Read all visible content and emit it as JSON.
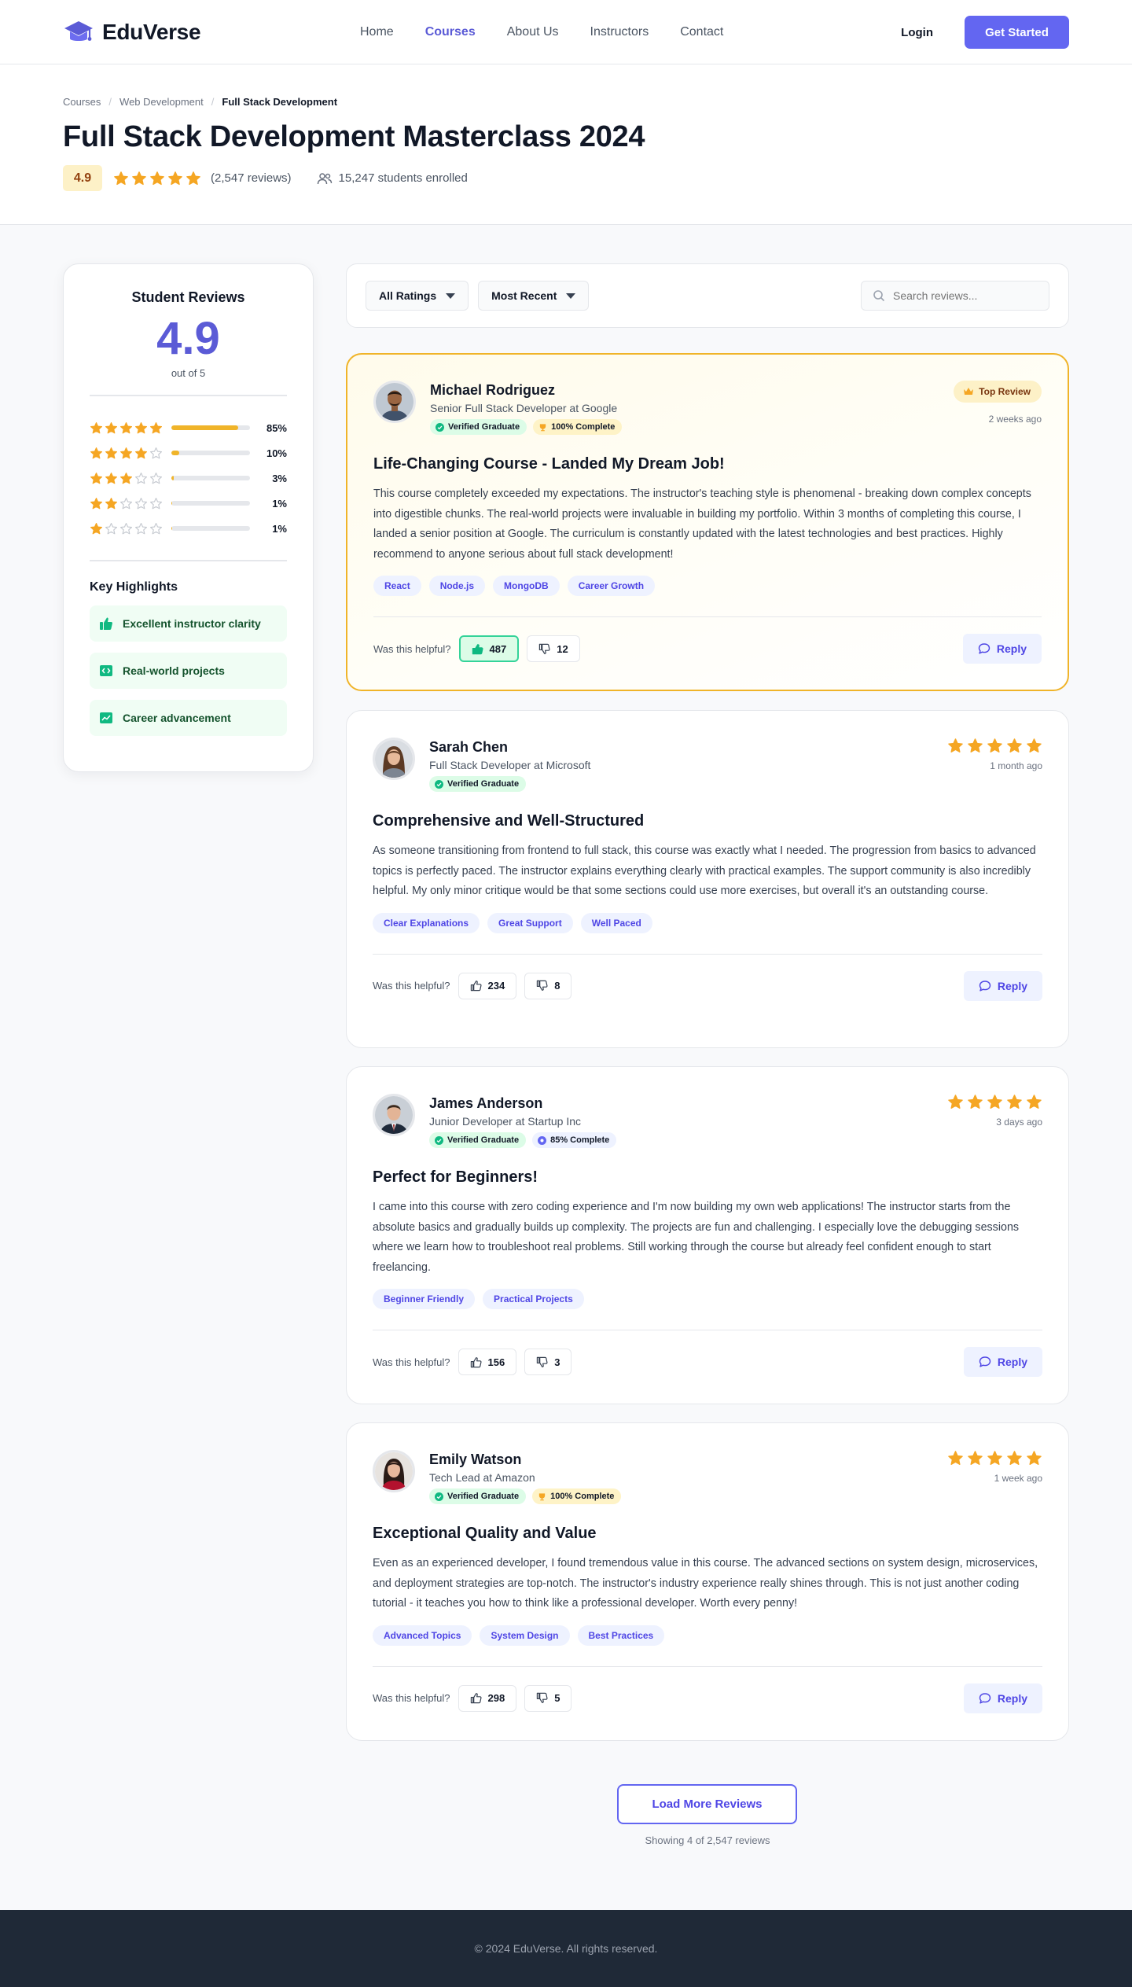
{
  "nav": {
    "brand": "EduVerse",
    "links": [
      "Home",
      "Courses",
      "About Us",
      "Instructors",
      "Contact"
    ],
    "active_index": 1,
    "login": "Login",
    "cta": "Get Started"
  },
  "breadcrumb": [
    "Courses",
    "Web Development",
    "Full Stack Development"
  ],
  "course": {
    "title": "Full Stack Development Masterclass 2024",
    "rating": "4.9",
    "stars": 5,
    "reviews": "(2,547 reviews)",
    "enrolled": "15,247 students enrolled"
  },
  "summary": {
    "title": "Student Reviews",
    "score": "4.9",
    "out_of": "out of 5",
    "distribution": [
      {
        "stars": 5,
        "pct": "85%",
        "value": 85
      },
      {
        "stars": 4,
        "pct": "10%",
        "value": 10
      },
      {
        "stars": 3,
        "pct": "3%",
        "value": 3
      },
      {
        "stars": 2,
        "pct": "1%",
        "value": 1
      },
      {
        "stars": 1,
        "pct": "1%",
        "value": 1
      }
    ],
    "highlights_title": "Key Highlights",
    "highlights": [
      "Excellent instructor clarity",
      "Real-world projects",
      "Career advancement"
    ]
  },
  "filters": {
    "rating": "All Ratings",
    "sort": "Most Recent",
    "search_placeholder": "Search reviews..."
  },
  "reviews": [
    {
      "name": "Michael Rodriguez",
      "role": "Senior Full Stack Developer at Google",
      "badges": [
        {
          "label": "Verified Graduate",
          "kind": "verified"
        },
        {
          "label": "100% Complete",
          "kind": "complete"
        }
      ],
      "top_label": "Top Review",
      "date": "2 weeks ago",
      "title": "Life-Changing Course - Landed My Dream Job!",
      "body": "This course completely exceeded my expectations. The instructor's teaching style is phenomenal - breaking down complex concepts into digestible chunks. The real-world projects were invaluable in building my portfolio. Within 3 months of completing this course, I landed a senior position at Google. The curriculum is constantly updated with the latest technologies and best practices. Highly recommend to anyone serious about full stack development!",
      "tags": [
        "React",
        "Node.js",
        "MongoDB",
        "Career Growth"
      ],
      "up": "487",
      "down": "12"
    },
    {
      "name": "Sarah Chen",
      "role": "Full Stack Developer at Microsoft",
      "badges": [
        {
          "label": "Verified Graduate",
          "kind": "verified"
        }
      ],
      "date": "1 month ago",
      "title": "Comprehensive and Well-Structured",
      "body": "As someone transitioning from frontend to full stack, this course was exactly what I needed. The progression from basics to advanced topics is perfectly paced. The instructor explains everything clearly with practical examples. The support community is also incredibly helpful. My only minor critique would be that some sections could use more exercises, but overall it's an outstanding course.",
      "tags": [
        "Clear Explanations",
        "Great Support",
        "Well Paced"
      ],
      "up": "234",
      "down": "8"
    },
    {
      "name": "James Anderson",
      "role": "Junior Developer at Startup Inc",
      "badges": [
        {
          "label": "Verified Graduate",
          "kind": "verified"
        },
        {
          "label": "85% Complete",
          "kind": "progress"
        }
      ],
      "date": "3 days ago",
      "title": "Perfect for Beginners!",
      "body": "I came into this course with zero coding experience and I'm now building my own web applications! The instructor starts from the absolute basics and gradually builds up complexity. The projects are fun and challenging. I especially love the debugging sessions where we learn how to troubleshoot real problems. Still working through the course but already feel confident enough to start freelancing.",
      "tags": [
        "Beginner Friendly",
        "Practical Projects"
      ],
      "up": "156",
      "down": "3"
    },
    {
      "name": "Emily Watson",
      "role": "Tech Lead at Amazon",
      "badges": [
        {
          "label": "Verified Graduate",
          "kind": "verified"
        },
        {
          "label": "100% Complete",
          "kind": "complete"
        }
      ],
      "date": "1 week ago",
      "title": "Exceptional Quality and Value",
      "body": "Even as an experienced developer, I found tremendous value in this course. The advanced sections on system design, microservices, and deployment strategies are top-notch. The instructor's industry experience really shines through. This is not just another coding tutorial - it teaches you how to think like a professional developer. Worth every penny!",
      "tags": [
        "Advanced Topics",
        "System Design",
        "Best Practices"
      ],
      "up": "298",
      "down": "5"
    }
  ],
  "helpful_label": "Was this helpful?",
  "reply_label": "Reply",
  "load_more": "Load More Reviews",
  "showing": "Showing 4 of 2,547 reviews",
  "footer": "© 2024 EduVerse. All rights reserved.",
  "colors": {
    "accent": "#6366f1",
    "star": "#f5a623",
    "top_border": "#f0b429",
    "verified": "#10b981"
  }
}
